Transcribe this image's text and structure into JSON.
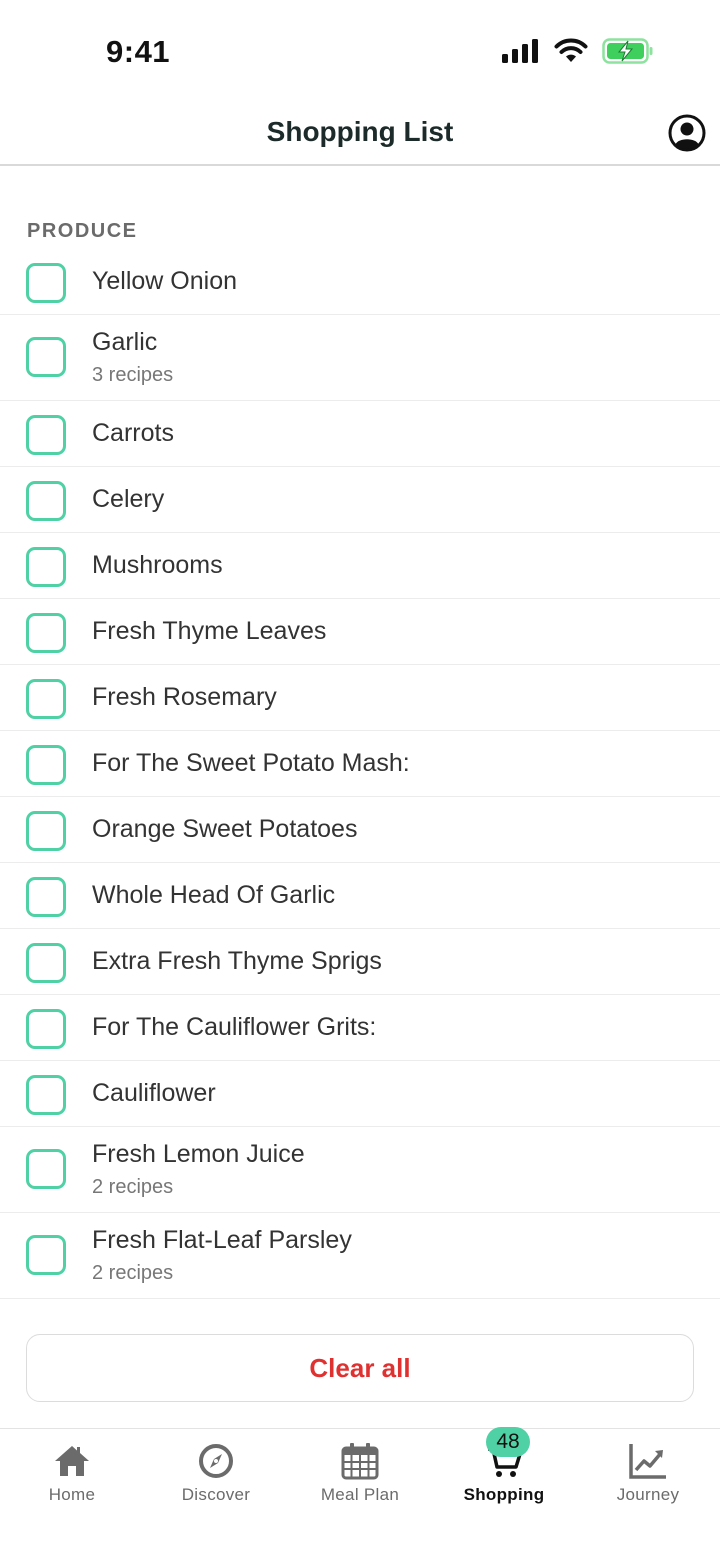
{
  "status_bar": {
    "time": "9:41"
  },
  "header": {
    "title": "Shopping List"
  },
  "section": {
    "label": "PRODUCE"
  },
  "items": [
    {
      "name": "Yellow Onion",
      "sub": ""
    },
    {
      "name": "Garlic",
      "sub": "3 recipes"
    },
    {
      "name": "Carrots",
      "sub": ""
    },
    {
      "name": "Celery",
      "sub": ""
    },
    {
      "name": "Mushrooms",
      "sub": ""
    },
    {
      "name": "Fresh Thyme Leaves",
      "sub": ""
    },
    {
      "name": "Fresh Rosemary",
      "sub": ""
    },
    {
      "name": "For The Sweet Potato Mash:",
      "sub": ""
    },
    {
      "name": "Orange Sweet Potatoes",
      "sub": ""
    },
    {
      "name": "Whole Head Of Garlic",
      "sub": ""
    },
    {
      "name": "Extra Fresh Thyme Sprigs",
      "sub": ""
    },
    {
      "name": "For The Cauliflower Grits:",
      "sub": ""
    },
    {
      "name": "Cauliflower",
      "sub": ""
    },
    {
      "name": "Fresh Lemon Juice",
      "sub": "2 recipes"
    },
    {
      "name": "Fresh Flat-Leaf Parsley",
      "sub": "2 recipes"
    }
  ],
  "clear_button": {
    "label": "Clear all"
  },
  "tabs": [
    {
      "label": "Home",
      "icon": "home-icon"
    },
    {
      "label": "Discover",
      "icon": "compass-icon"
    },
    {
      "label": "Meal Plan",
      "icon": "calendar-icon"
    },
    {
      "label": "Shopping",
      "icon": "cart-icon",
      "badge": "48",
      "active": true
    },
    {
      "label": "Journey",
      "icon": "chart-icon"
    }
  ],
  "colors": {
    "accent": "#4fd1a5",
    "danger": "#e03131",
    "battery": "#3fcf5d"
  }
}
